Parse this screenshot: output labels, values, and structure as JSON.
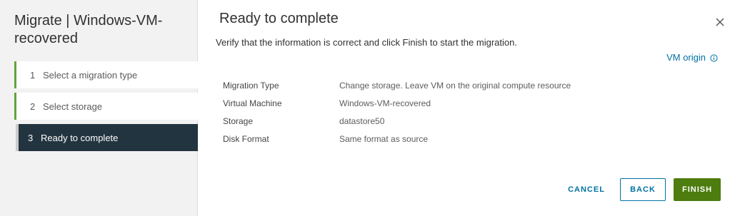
{
  "sidebar": {
    "title": "Migrate | Windows-VM-recovered",
    "steps": [
      {
        "number": "1",
        "label": "Select a migration type",
        "state": "completed"
      },
      {
        "number": "2",
        "label": "Select storage",
        "state": "completed"
      },
      {
        "number": "3",
        "label": "Ready to complete",
        "state": "active"
      }
    ]
  },
  "main": {
    "title": "Ready to complete",
    "subtitle": "Verify that the information is correct and click Finish to start the migration.",
    "origin_link": "VM origin",
    "summary": [
      {
        "key": "Migration Type",
        "value": "Change storage. Leave VM on the original compute resource"
      },
      {
        "key": "Virtual Machine",
        "value": "Windows-VM-recovered"
      },
      {
        "key": "Storage",
        "value": "datastore50"
      },
      {
        "key": "Disk Format",
        "value": "Same format as source"
      }
    ]
  },
  "footer": {
    "cancel_label": "CANCEL",
    "back_label": "BACK",
    "finish_label": "FINISH"
  },
  "icons": {
    "close": "close-icon",
    "info": "info-icon"
  },
  "colors": {
    "accent_link": "#0072a3",
    "finish_green": "#4d7c0f",
    "step_complete_bar": "#60a53b",
    "active_step_bg": "#22343f"
  }
}
